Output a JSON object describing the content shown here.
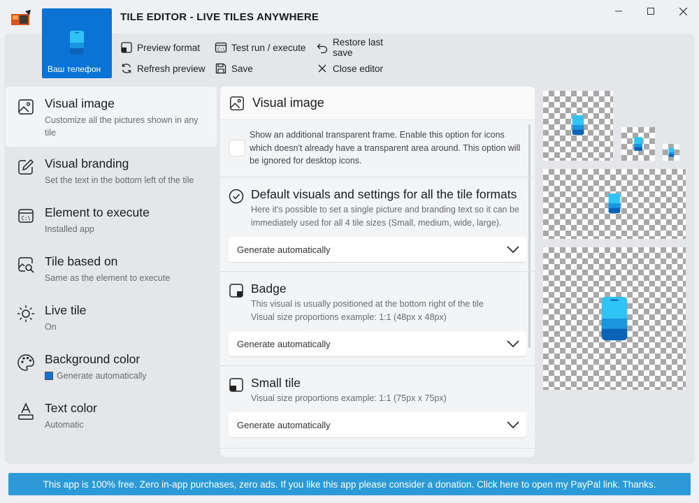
{
  "window": {
    "title": "TILE EDITOR - LIVE TILES ANYWHERE",
    "minimize_icon": "minimize-icon",
    "maximize_icon": "maximize-icon",
    "close_icon": "close-icon"
  },
  "tile": {
    "label": "Ваш телефон",
    "icon": "phone-icon",
    "color": "#0a74d6"
  },
  "toolbar": {
    "preview_format": "Preview format",
    "test_run": "Test run / execute",
    "restore": "Restore last save",
    "refresh": "Refresh preview",
    "save": "Save",
    "close_editor": "Close editor"
  },
  "sidebar": {
    "items": [
      {
        "title": "Visual image",
        "subtitle": "Customize all the pictures shown in any tile",
        "icon": "image-icon"
      },
      {
        "title": "Visual branding",
        "subtitle": "Set the text in the bottom left of the tile",
        "icon": "edit-icon"
      },
      {
        "title": "Element to execute",
        "subtitle": "Installed app",
        "icon": "terminal-icon"
      },
      {
        "title": "Tile based on",
        "subtitle": "Same as the element to execute",
        "icon": "search-image-icon"
      },
      {
        "title": "Live tile",
        "subtitle": "On",
        "icon": "brightness-icon"
      },
      {
        "title": "Background color",
        "subtitle": "Generate automatically",
        "icon": "palette-icon"
      },
      {
        "title": "Text color",
        "subtitle": "Automatic",
        "icon": "text-color-icon"
      }
    ]
  },
  "content": {
    "header": "Visual image",
    "transparent_frame_text": "Show an additional transparent frame. Enable this option for icons which doesn't already have a transparent area around. This option will be ignored for desktop icons.",
    "default_title": "Default visuals and settings for all the tile formats",
    "default_desc": "Here it's possible to set a single picture and branding text so it can be immediately used for all 4 tile sizes (Small, medium, wide, large).",
    "default_dropdown": "Generate automatically",
    "badge_title": "Badge",
    "badge_desc1": "This visual is usually positioned at the bottom right of the tile",
    "badge_desc2": "Visual size proportions example: 1:1 (48px x 48px)",
    "badge_dropdown": "Generate automatically",
    "small_title": "Small tile",
    "small_desc": "Visual size proportions example: 1:1 (75px x 75px)",
    "small_dropdown": "Generate automatically"
  },
  "banner": {
    "text": "This app is 100% free. Zero in-app purchases, zero ads. If you like this app please consider a donation. Click here to open my PayPal link. Thanks."
  }
}
